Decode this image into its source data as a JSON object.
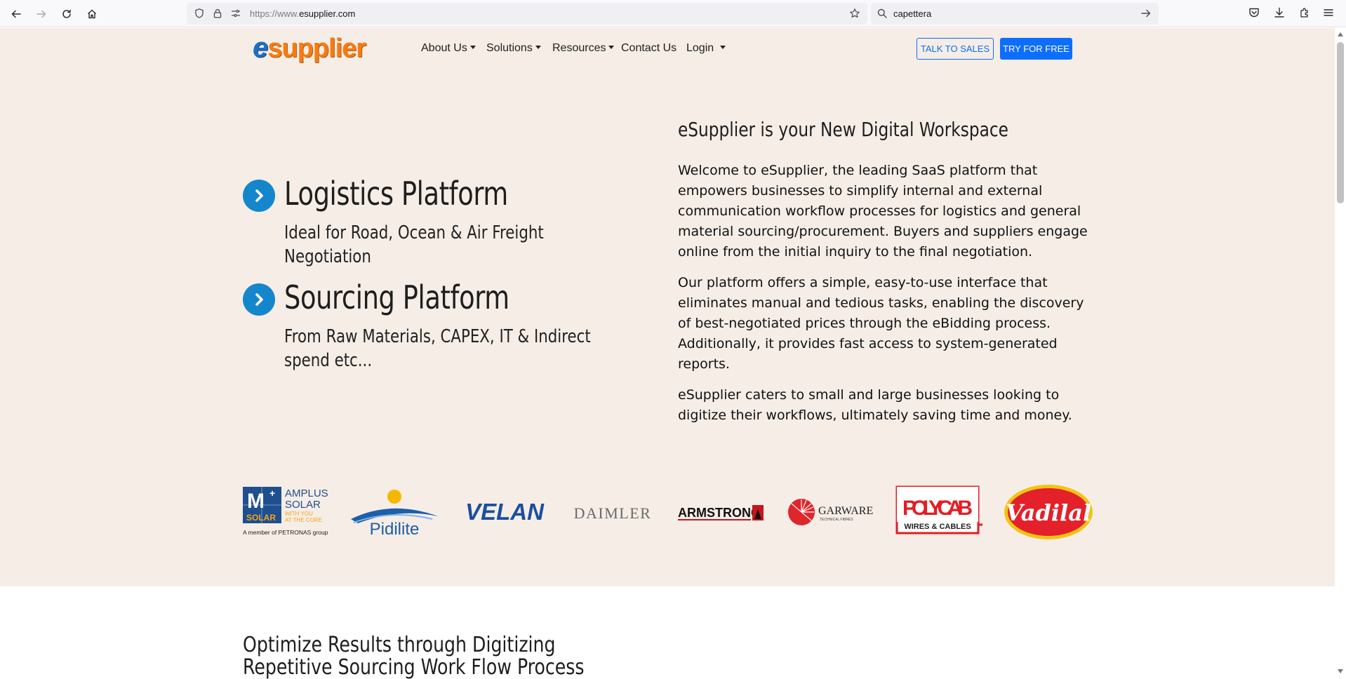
{
  "browser": {
    "url_prefix": "https://www.",
    "url_domain": "esupplier.com",
    "search_query": "capettera"
  },
  "header": {
    "logo_e": "e",
    "logo_text": "supplier",
    "nav": [
      {
        "label": "About Us",
        "dropdown": true
      },
      {
        "label": "Solutions",
        "dropdown": true
      },
      {
        "label": "Resources",
        "dropdown": true
      },
      {
        "label": "Contact Us",
        "dropdown": false
      },
      {
        "label": "Login",
        "dropdown": true
      }
    ],
    "talk_to_sales": "TALK TO SALES",
    "try_for_free": "TRY FOR FREE"
  },
  "platforms": [
    {
      "title": "Logistics Platform",
      "subtitle": "Ideal for Road, Ocean & Air Freight Negotiation"
    },
    {
      "title": "Sourcing Platform",
      "subtitle": "From Raw Materials, CAPEX, IT & Indirect spend etc..."
    }
  ],
  "intro": {
    "title": "eSupplier is your New Digital Workspace",
    "paragraphs": [
      "Welcome to eSupplier, the leading SaaS platform that empowers businesses to simplify internal and external communication workflow processes for logistics and general material sourcing/procurement. Buyers and suppliers engage online from the initial inquiry to the final negotiation.",
      "Our platform offers a simple, easy-to-use interface that eliminates manual and tedious tasks, enabling the discovery of best-negotiated prices through the eBidding process. Additionally, it provides fast access to system-generated reports.",
      "eSupplier caters to small and large businesses looking to digitize their workflows, ultimately saving time and money."
    ]
  },
  "client_logos": {
    "amplus": {
      "mark_m": "M",
      "mark_plus": "+",
      "mark_solar": "SOLAR",
      "line1": "AMPLUS",
      "line2": "SOLAR",
      "tag1": "WITH YOU",
      "tag2": "AT THE CORE",
      "member": "A member of PETRONAS group"
    },
    "pidilite": "Pidilite",
    "velan": "VELAN",
    "daimler": "DAIMLER",
    "armstrong": "ARMSTRONG",
    "garware": {
      "name": "GARWARE",
      "tag": "TECHNICAL FIBRES"
    },
    "polycab": {
      "name": "POLYCAB",
      "tag": "WIRES & CABLES"
    },
    "vadilal": "Vadilal"
  },
  "colors": {
    "hero_bg": "#f5ede6",
    "brand_orange": "#f57c14",
    "brand_blue": "#1d6fc4",
    "cta_blue": "#0d6efd",
    "icon_blue": "#1486cc"
  },
  "lower_section": {
    "title": "Optimize Results through Digitizing Repetitive Sourcing Work Flow Process"
  }
}
